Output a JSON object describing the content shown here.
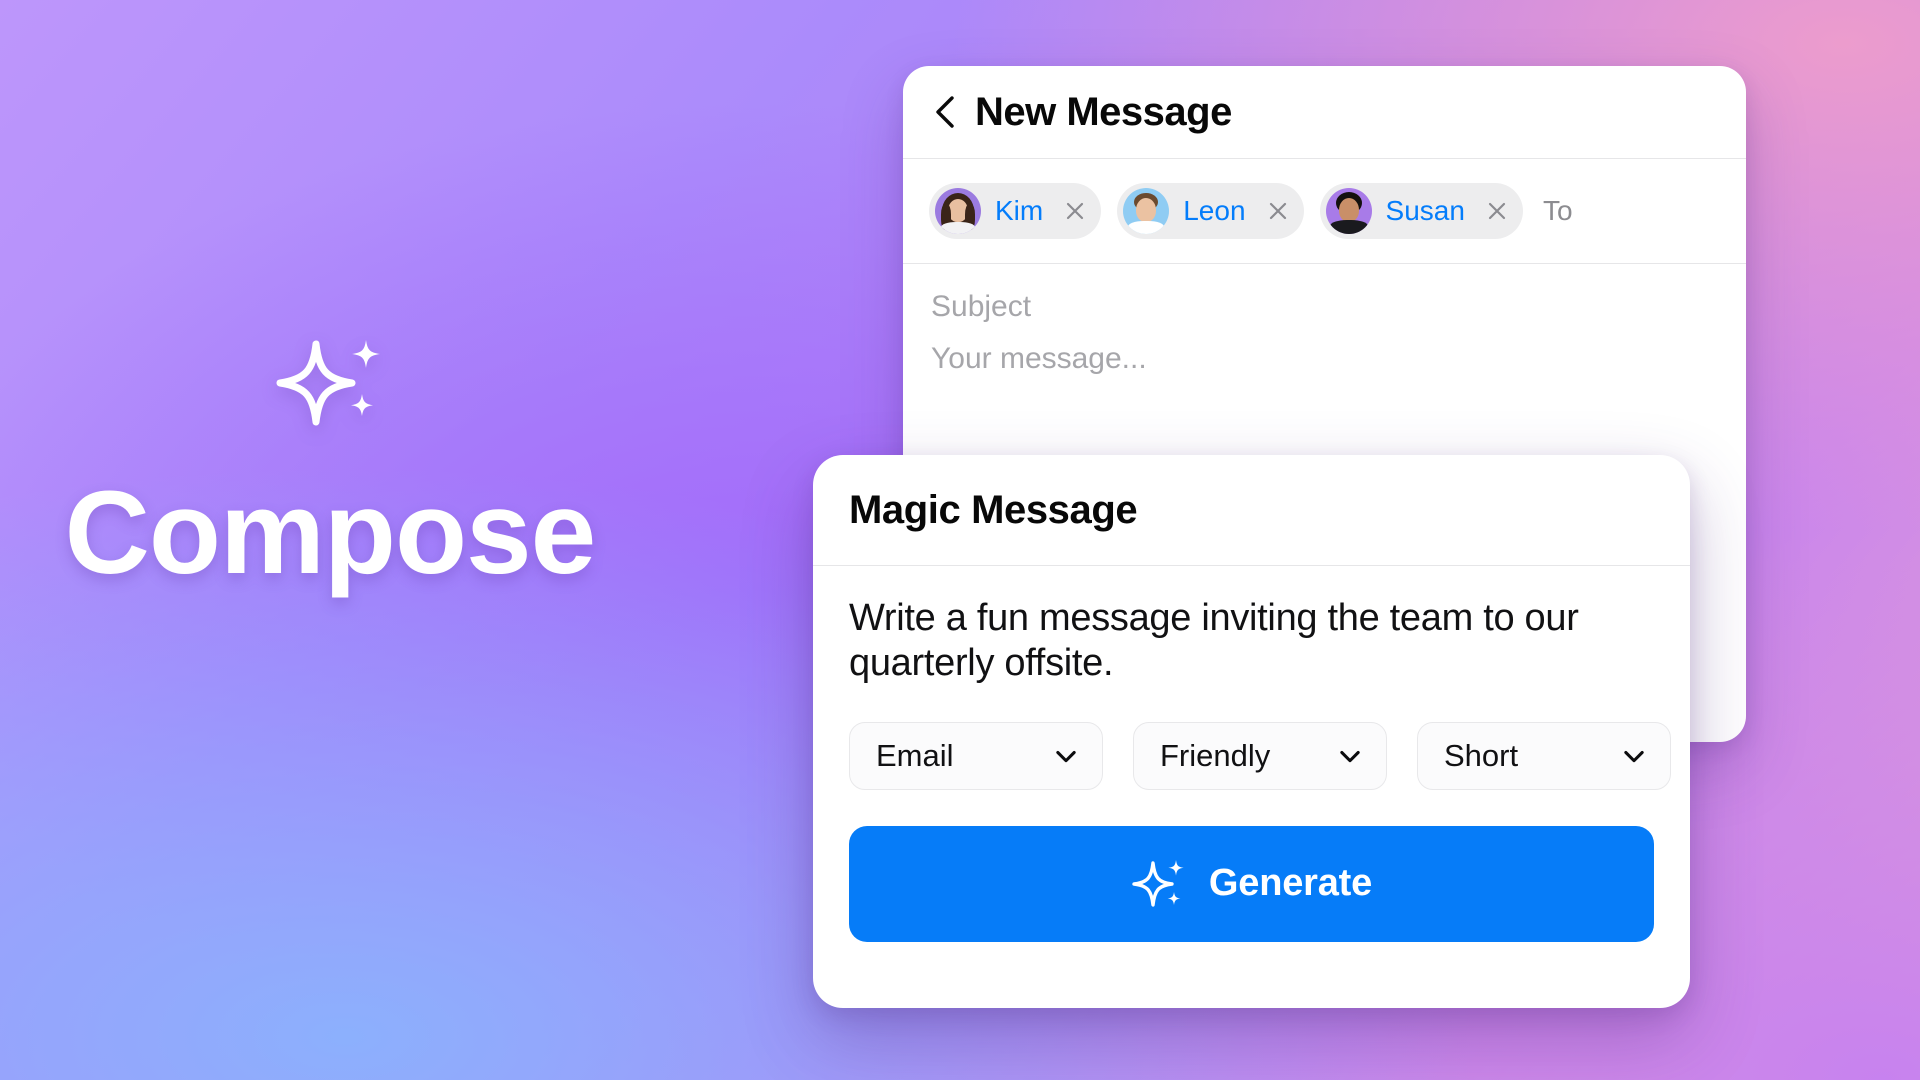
{
  "hero": {
    "title": "Compose",
    "sparkle_icon": "sparkle-icon"
  },
  "colors": {
    "accent_blue": "#047DFB",
    "button_blue": "#067CF8",
    "chip_bg": "#EDEDEE",
    "placeholder_gray": "#A6A6AA",
    "bg_top_left": "#BD96FB",
    "bg_top_right": "#E9A0CD",
    "bg_bottom_left": "#91B5FD",
    "bg_bottom_right": "#C683EE"
  },
  "message_card": {
    "back_icon": "chevron-left-icon",
    "title": "New Message",
    "to_label": "To",
    "recipients": [
      {
        "name": "Kim",
        "avatar_bg": "#9B7BE0",
        "hair": "#3A2418",
        "skin": "#E8BFA0",
        "shirt": "#F2F2F4",
        "remove_icon": "close-icon"
      },
      {
        "name": "Leon",
        "avatar_bg": "#8FCCF3",
        "hair": "#6B4A2E",
        "skin": "#EBC2A2",
        "shirt": "#FFFFFF",
        "remove_icon": "close-icon"
      },
      {
        "name": "Susan",
        "avatar_bg": "#A87BE8",
        "hair": "#14100E",
        "skin": "#C98F68",
        "shirt": "#1A1A1E",
        "remove_icon": "close-icon"
      }
    ],
    "subject_placeholder": "Subject",
    "body_placeholder": "Your message..."
  },
  "magic_card": {
    "title": "Magic Message",
    "prompt": "Write a fun message inviting the team to our quarterly offsite.",
    "selects": [
      {
        "value": "Email",
        "icon": "chevron-down-icon"
      },
      {
        "value": "Friendly",
        "icon": "chevron-down-icon"
      },
      {
        "value": "Short",
        "icon": "chevron-down-icon"
      }
    ],
    "generate": {
      "label": "Generate",
      "icon": "sparkle-icon"
    }
  }
}
